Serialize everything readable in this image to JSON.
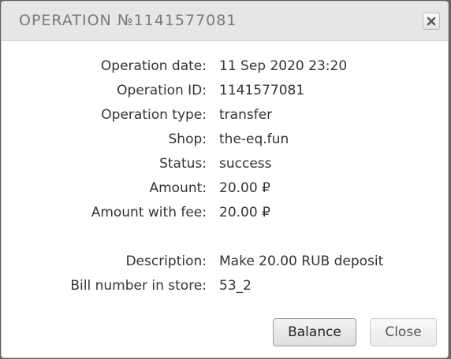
{
  "dialog": {
    "title": "OPERATION №1141577081",
    "close_icon": "close-x-icon"
  },
  "details": [
    {
      "label": "Operation date:",
      "value": "11 Sep 2020 23:20"
    },
    {
      "label": "Operation ID:",
      "value": "1141577081"
    },
    {
      "label": "Operation type:",
      "value": "transfer"
    },
    {
      "label": "Shop:",
      "value": "the-eq.fun"
    },
    {
      "label": "Status:",
      "value": "success"
    },
    {
      "label": "Amount:",
      "value": "20.00 ₽"
    },
    {
      "label": "Amount with fee:",
      "value": "20.00 ₽"
    },
    {
      "label": "Description:",
      "value": "Make 20.00 RUB deposit"
    },
    {
      "label": "Bill number in store:",
      "value": "53_2"
    }
  ],
  "buttons": {
    "balance_label": "Balance",
    "close_label": "Close"
  }
}
